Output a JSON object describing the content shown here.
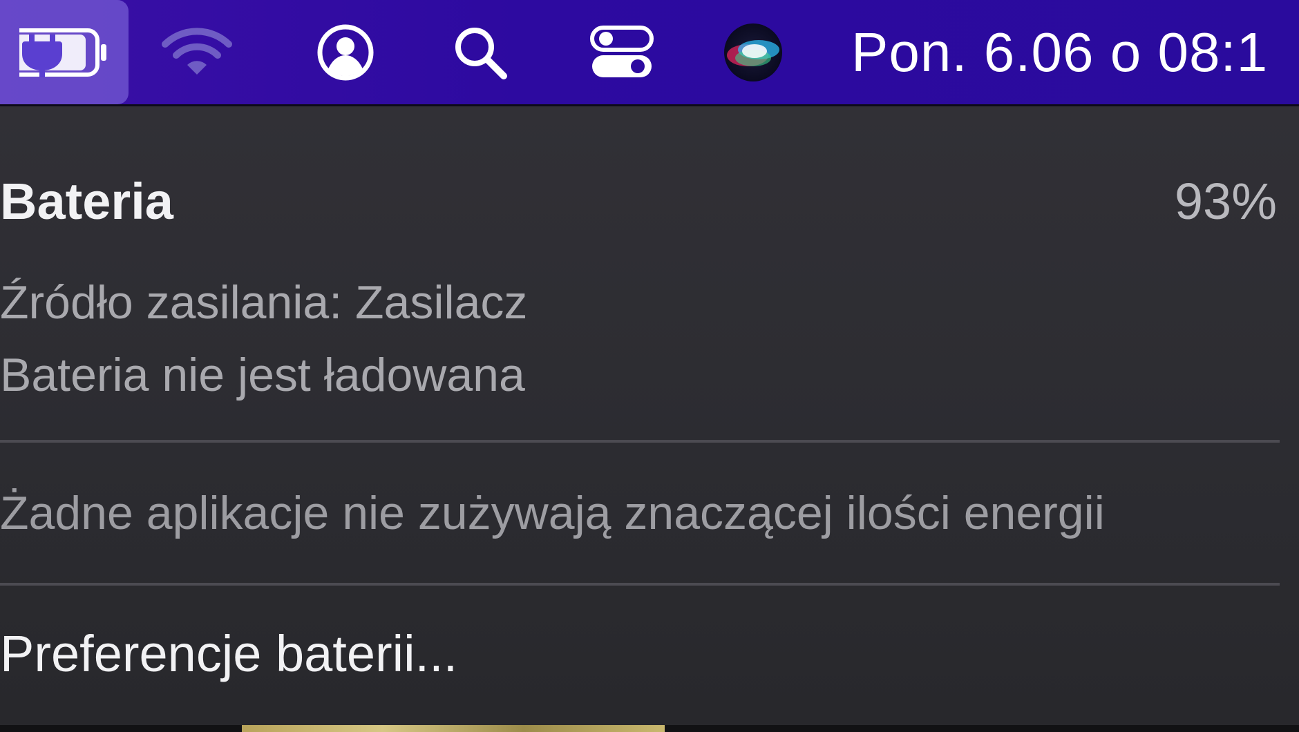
{
  "menubar": {
    "icons": {
      "battery": "battery-charging-icon",
      "wifi": "wifi-icon",
      "user": "user-account-icon",
      "search": "search-icon",
      "control_center": "control-center-icon",
      "siri": "siri-icon"
    },
    "clock": "Pon. 6.06 o  08:1"
  },
  "battery_menu": {
    "title": "Bateria",
    "percent": "93%",
    "power_source": "Źródło zasilania: Zasilacz",
    "charging_status": "Bateria nie jest ładowana",
    "energy_note": "Żadne aplikacje nie zużywają znaczącej ilości energii",
    "preferences": "Preferencje baterii..."
  },
  "colors": {
    "menubar": "#2d0aa0",
    "panel": "#2e2d33",
    "text_primary": "#f2f2f4",
    "text_secondary": "#a9a9ae"
  }
}
